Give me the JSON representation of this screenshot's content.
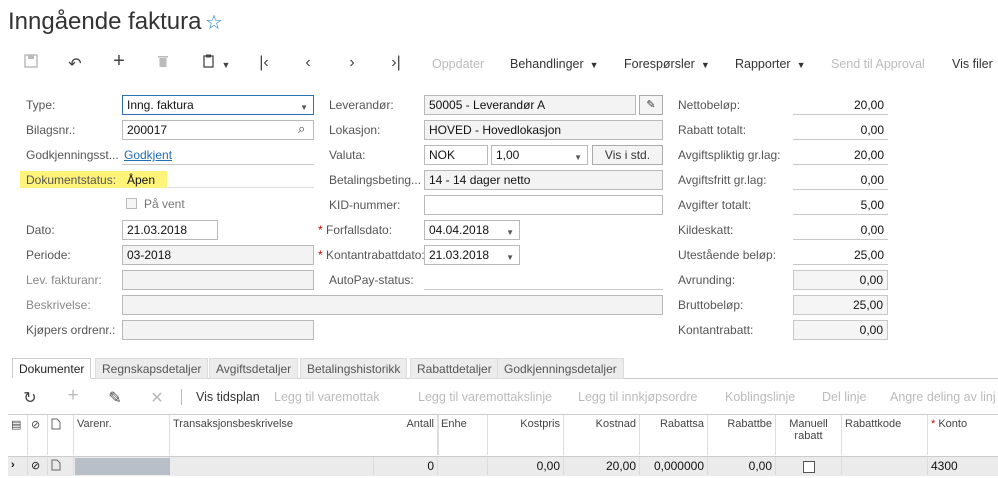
{
  "page": {
    "title": "Inngående faktura"
  },
  "toolbar": {
    "update": "Oppdater",
    "actions": "Behandlinger",
    "inquiries": "Forespørsler",
    "reports": "Rapporter",
    "send_approval": "Send til Approval",
    "show_files": "Vis filer"
  },
  "form": {
    "type_label": "Type:",
    "type_value": "Inng. faktura",
    "ref_label": "Bilagsnr.:",
    "ref_value": "200017",
    "approval_label": "Godkjenningsst...",
    "approval_value": "Godkjent",
    "docstatus_label": "Dokumentstatus:",
    "docstatus_value": "Åpen",
    "hold_label": "På vent",
    "date_label": "Dato:",
    "date_value": "21.03.2018",
    "period_label": "Periode:",
    "period_value": "03-2018",
    "vendor_invoice_label": "Lev. fakturanr:",
    "description_label": "Beskrivelse:",
    "buyer_order_label": "Kjøpers ordrenr.:",
    "vendor_label": "Leverandør:",
    "vendor_value": "50005 - Leverandør A",
    "location_label": "Lokasjon:",
    "location_value": "HOVED - Hovedlokasjon",
    "currency_label": "Valuta:",
    "currency_value": "NOK",
    "rate_value": "1,00",
    "view_base_button": "Vis i std.",
    "terms_label": "Betalingsbeting...",
    "terms_value": "14 - 14 dager netto",
    "kid_label": "KID-nummer:",
    "due_label": "Forfallsdato:",
    "due_value": "04.04.2018",
    "cashdisc_date_label": "Kontantrabattdato:",
    "cashdisc_date_value": "21.03.2018",
    "autopay_label": "AutoPay-status:",
    "net_label": "Nettobeløp:",
    "net_value": "20,00",
    "disc_total_label": "Rabatt totalt:",
    "disc_total_value": "0,00",
    "taxable_label": "Avgiftspliktig gr.lag:",
    "taxable_value": "20,00",
    "exempt_label": "Avgiftsfritt gr.lag:",
    "exempt_value": "0,00",
    "tax_total_label": "Avgifter totalt:",
    "tax_total_value": "5,00",
    "withholding_label": "Kildeskatt:",
    "withholding_value": "0,00",
    "balance_label": "Utestående beløp:",
    "balance_value": "25,00",
    "rounding_label": "Avrunding:",
    "rounding_value": "0,00",
    "gross_label": "Bruttobeløp:",
    "gross_value": "25,00",
    "cashdisc_label": "Kontantrabatt:",
    "cashdisc_value": "0,00"
  },
  "tabs": [
    "Dokumenter",
    "Regnskapsdetaljer",
    "Avgiftsdetaljer",
    "Betalingshistorikk",
    "Rabattdetaljer",
    "Godkjenningsdetaljer"
  ],
  "grid_toolbar": {
    "schedule": "Vis tidsplan",
    "add_receipt": "Legg til varemottak",
    "add_receipt_line": "Legg til varemottakslinje",
    "add_po": "Legg til innkjøpsordre",
    "link_line": "Koblingslinje",
    "split_line": "Del linje",
    "undo_discount": "Angre deling av linj"
  },
  "grid": {
    "headers": {
      "item": "Varenr.",
      "desc": "Transaksjonsbeskrivelse",
      "qty": "Antall",
      "unit": "Enhe",
      "unitcost": "Kostpris",
      "cost": "Kostnad",
      "discpct": "Rabattsa",
      "discamt": "Rabattbe",
      "manual": "Manuell rabatt",
      "disccode": "Rabattkode",
      "account": "Konto"
    },
    "rows": [
      {
        "qty": "0",
        "unitcost": "0,00",
        "cost": "20,00",
        "discpct": "0,000000",
        "discamt": "0,00",
        "account": "4300"
      }
    ]
  }
}
